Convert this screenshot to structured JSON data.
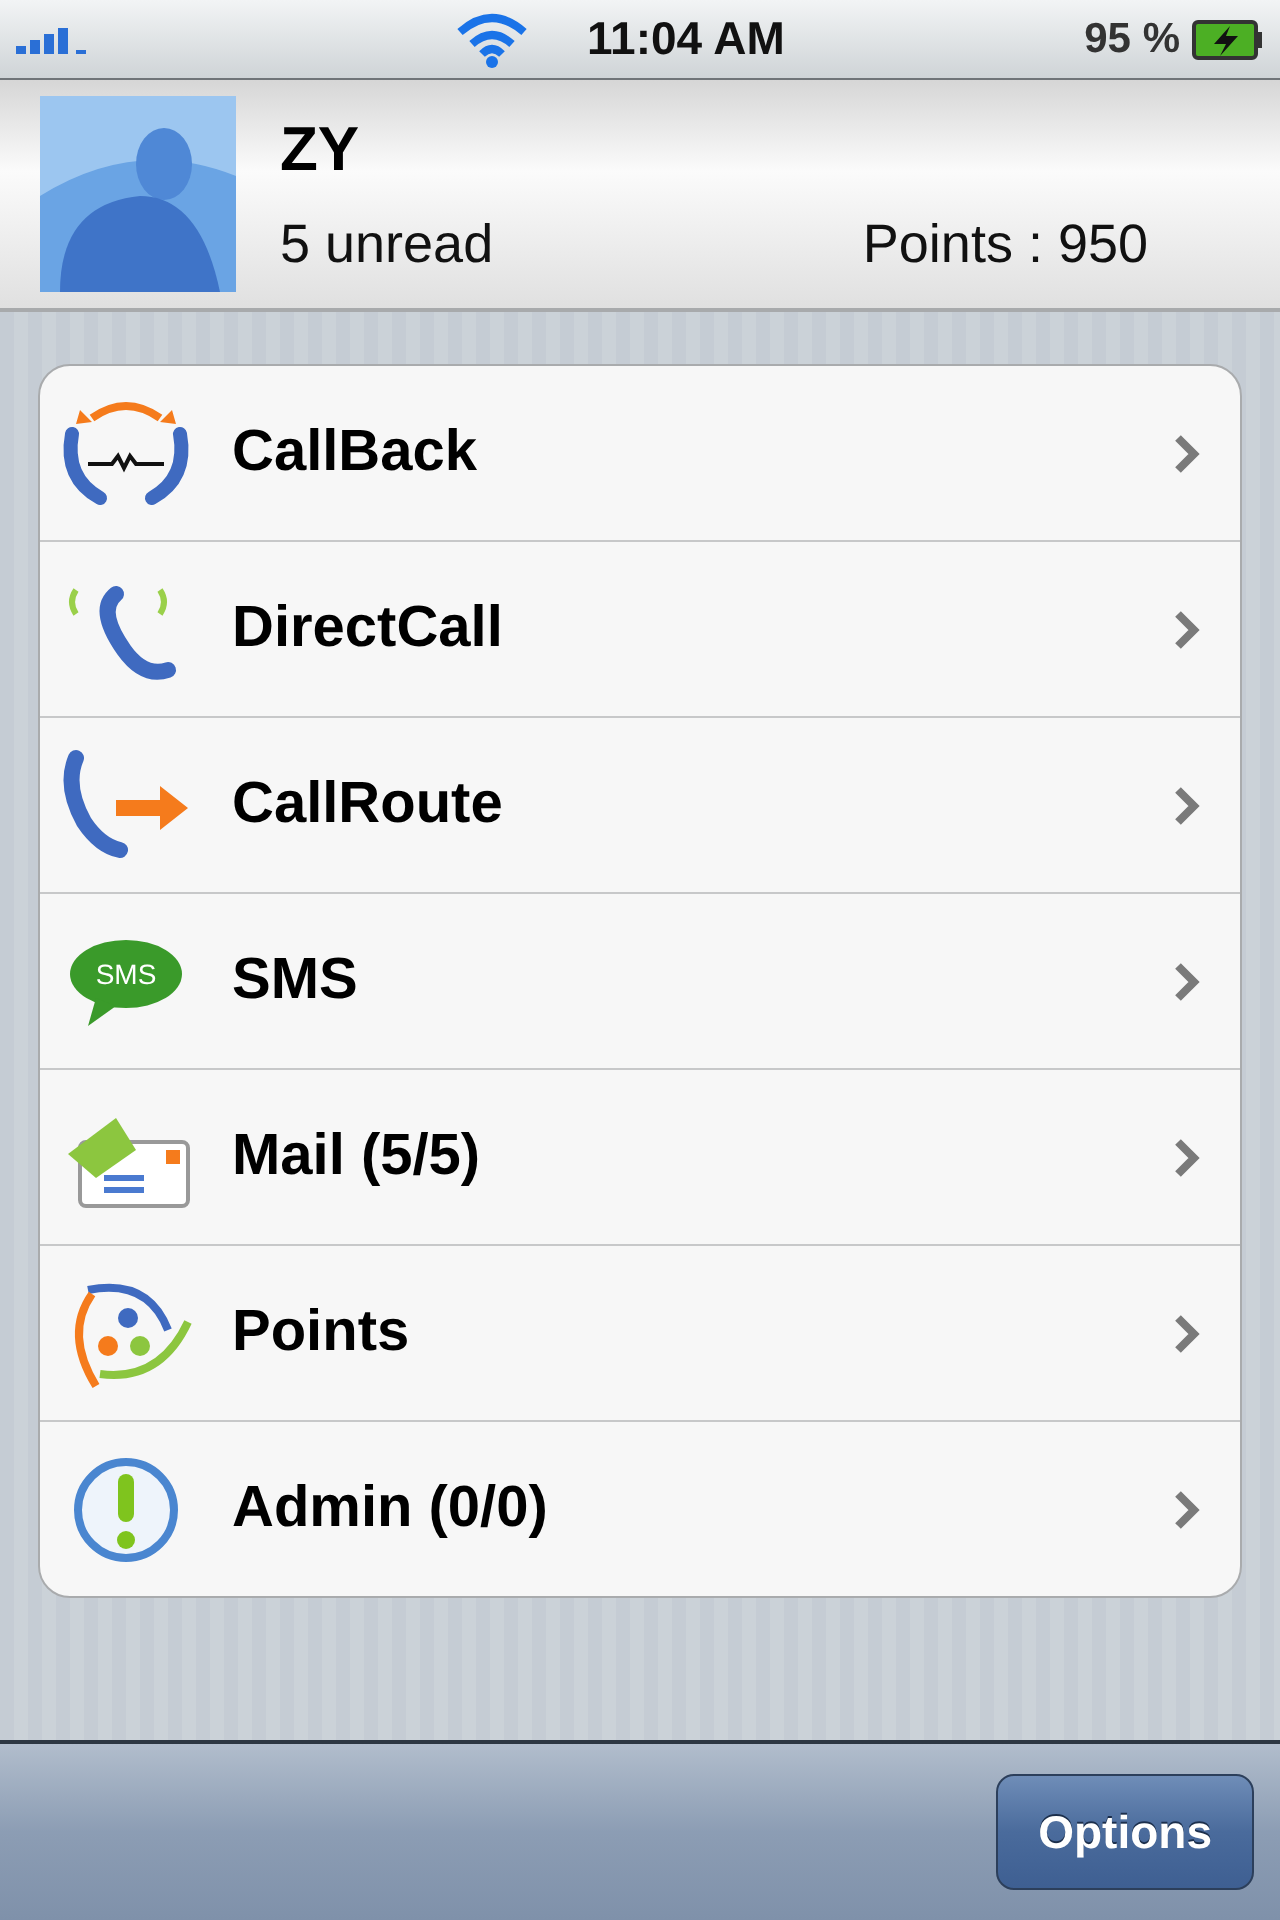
{
  "status_bar": {
    "time": "11:04 AM",
    "battery": "95 %"
  },
  "profile": {
    "name": "ZY",
    "unread": "5 unread",
    "points": "Points : 950"
  },
  "menu": [
    {
      "label": "CallBack",
      "kind": "callback"
    },
    {
      "label": "DirectCall",
      "kind": "directcall"
    },
    {
      "label": "CallRoute",
      "kind": "callroute"
    },
    {
      "label": "SMS",
      "kind": "sms",
      "icon_text": "SMS"
    },
    {
      "label": "Mail (5/5)",
      "kind": "mail"
    },
    {
      "label": "Points",
      "kind": "points"
    },
    {
      "label": "Admin (0/0)",
      "kind": "admin"
    }
  ],
  "toolbar": {
    "button": "Options"
  }
}
